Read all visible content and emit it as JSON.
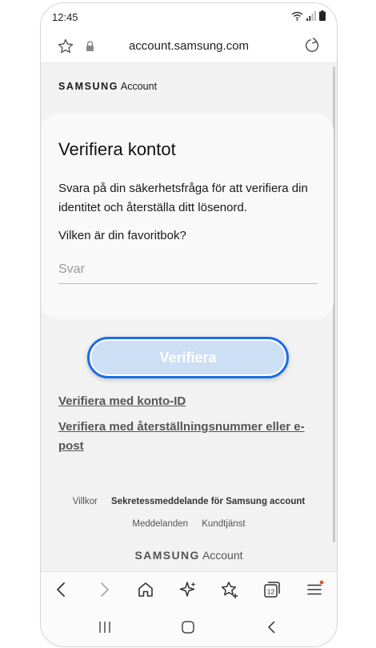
{
  "status": {
    "time": "12:45"
  },
  "browser": {
    "url": "account.samsung.com"
  },
  "logo": {
    "brand": "SAMSUNG",
    "product": "Account"
  },
  "card": {
    "title": "Verifiera kontot",
    "description": "Svara på din säkerhetsfråga för att verifiera din identitet och återställa ditt lösenord.",
    "question": "Vilken är din favoritbok?",
    "answer": {
      "value": "",
      "placeholder": "Svar"
    }
  },
  "verify_button": {
    "label": "Verifiera",
    "state": "disabled"
  },
  "links": {
    "account_id": "Verifiera med konto-ID",
    "recovery": "Verifiera med återställningsnummer eller e-post"
  },
  "footer": {
    "terms": "Villkor",
    "privacy": "Sekretessmeddelande för Samsung account",
    "notices": "Meddelanden",
    "support": "Kundtjänst",
    "brand": "SAMSUNG",
    "product": "Account"
  },
  "toolbar": {
    "back_icon": "chevron-left-icon",
    "forward_icon": "chevron-right-icon",
    "home_icon": "home-icon",
    "ai_icon": "sparkle-icon",
    "bookmarks_icon": "star-add-icon",
    "tabs_count": "12",
    "menu_icon": "menu-icon"
  },
  "colors": {
    "accent": "#1a6ee6",
    "button_fill": "#cddff5",
    "notification_dot": "#e8562a"
  }
}
